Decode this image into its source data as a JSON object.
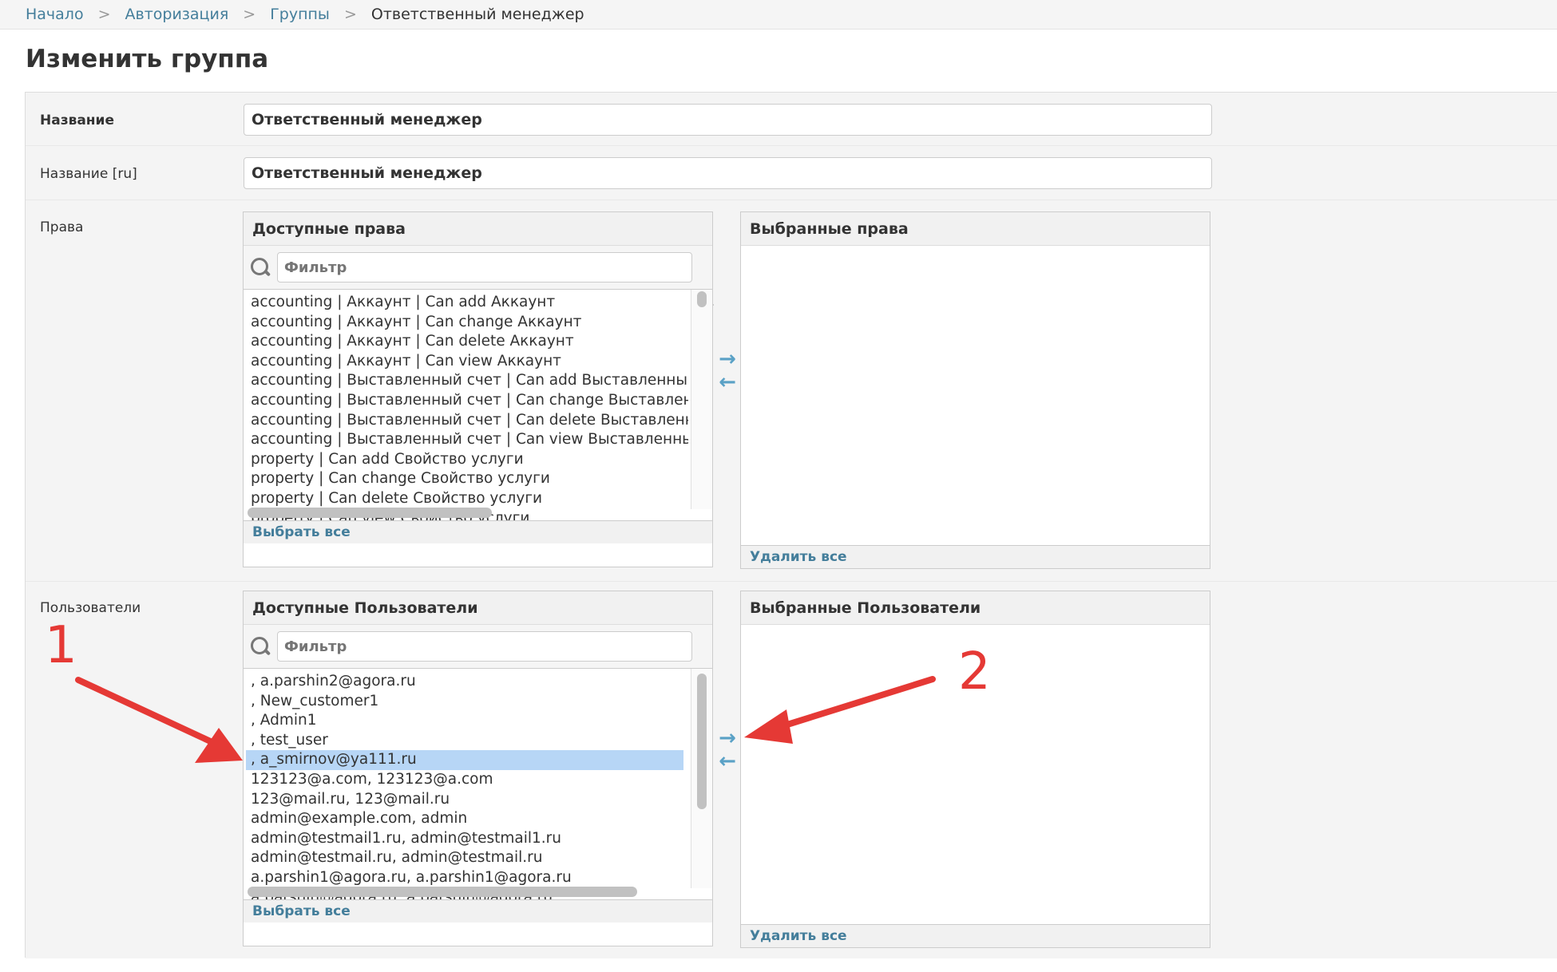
{
  "breadcrumbs": [
    "Начало",
    "Авторизация",
    "Группы",
    "Ответственный менеджер"
  ],
  "breadcrumb_separator": ">",
  "page_title": "Изменить группа",
  "fields": {
    "name": {
      "label": "Название",
      "value": "Ответственный менеджер"
    },
    "name_ru": {
      "label": "Название [ru]",
      "value": "Ответственный менеджер"
    }
  },
  "permissions": {
    "label": "Права",
    "available_title": "Доступные права",
    "chosen_title": "Выбранные права",
    "filter_placeholder": "Фильтр",
    "choose_all": "Выбрать все",
    "remove_all": "Удалить все",
    "items": [
      "accounting | Аккаунт | Can add Аккаунт",
      "accounting | Аккаунт | Can change Аккаунт",
      "accounting | Аккаунт | Can delete Аккаунт",
      "accounting | Аккаунт | Can view Аккаунт",
      "accounting | Выставленный счет | Can add Выставленный счет",
      "accounting | Выставленный счет | Can change Выставленный счет",
      "accounting | Выставленный счет | Can delete Выставленный счет",
      "accounting | Выставленный счет | Can view Выставленный счет",
      "property | Can add Свойство услуги",
      "property | Can change Свойство услуги",
      "property | Can delete Свойство услуги",
      "property | Can view Свойство услуги"
    ]
  },
  "users": {
    "label": "Пользователи",
    "available_title": "Доступные Пользователи",
    "chosen_title": "Выбранные Пользователи",
    "filter_placeholder": "Фильтр",
    "choose_all": "Выбрать все",
    "remove_all": "Удалить все",
    "selected_item": ", a_smirnov@ya111.ru",
    "items": [
      ", a.parshin2@agora.ru",
      ", New_customer1",
      ", Admin1",
      ", test_user",
      ", a_smirnov@ya111.ru",
      "123123@a.com, 123123@a.com",
      "123@mail.ru, 123@mail.ru",
      "admin@example.com, admin",
      "admin@testmail1.ru, admin@testmail1.ru",
      "admin@testmail.ru, admin@testmail.ru",
      "a.parshin1@agora.ru, a.parshin1@agora.ru",
      "a.parshin@agora.ru, a.parshin@agora.ru"
    ]
  },
  "mover_icons": {
    "add": "arrow-right-icon",
    "remove": "arrow-left-icon"
  },
  "annotations": {
    "one": "1",
    "two": "2",
    "color": "#e53935"
  }
}
